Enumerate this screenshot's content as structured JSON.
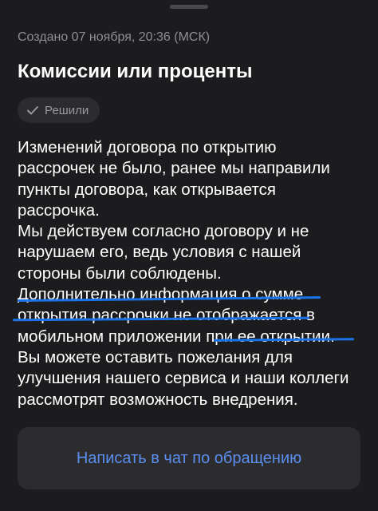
{
  "header": {
    "created": "Создано 07 ноября, 20:36 (МСК)",
    "title": "Комиссии или проценты"
  },
  "status": {
    "label": "Решили",
    "icon": "checkmark-icon"
  },
  "message": {
    "lines": [
      "Изменений договора по открытию",
      "рассрочек не было, ранее мы направили",
      "пункты договора, как открывается",
      "рассрочка.",
      "Мы действуем согласно договору и не",
      "нарушаем его, ведь условия с нашей",
      "стороны были соблюдены.",
      "Дополнительно информация о сумме",
      "открытия рассрочки не отображается в",
      "мобильном приложении при ее открытии.",
      "Вы можете оставить пожелания для",
      "улучшения нашего сервиса и наши коллеги",
      "рассмотрят возможность внедрения."
    ]
  },
  "actions": {
    "chat_button": "Написать в чат по обращению"
  },
  "colors": {
    "background": "#1c1c1e",
    "surface": "#2c2c2e",
    "accent": "#5b8def",
    "annotation": "#1a73e8",
    "muted_text": "#8e8e93"
  }
}
